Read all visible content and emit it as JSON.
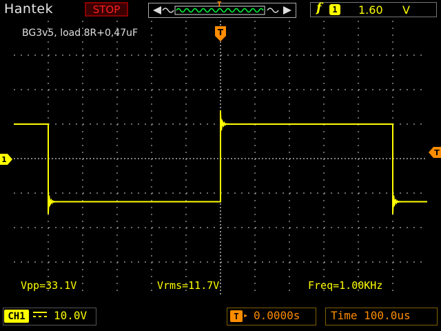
{
  "header": {
    "brand": "Hantek",
    "run_state": "STOP",
    "trigger_edge_symbol": "f",
    "trigger_channel": "1",
    "trigger_level": "1.60",
    "trigger_unit": "V",
    "trigger_marker": "T"
  },
  "screen": {
    "caption": "BG3v5, load 8R+0,47uF",
    "ch1_marker": "1",
    "trigger_marker": "T"
  },
  "measurements": {
    "vpp": "Vpp=33.1V",
    "vrms": "Vrms=11.7V",
    "freq": "Freq=1.00KHz"
  },
  "footer": {
    "ch1_label": "CH1",
    "coupling_symbol": "DC",
    "ch1_scale": "10.0V",
    "trigger_position_icon": "T",
    "trigger_position": "0.0000s",
    "timebase": "Time 100.0us"
  },
  "colors": {
    "trace": "#ffff00",
    "grid": "#b0b0b0",
    "accent": "#ff8c00",
    "stop": "#ff2020"
  },
  "trace": {
    "high_level_div": 1.0,
    "low_level_div": -1.25,
    "period_div": 10,
    "transitions_div": [
      -5.0,
      0.0,
      5.0
    ]
  }
}
